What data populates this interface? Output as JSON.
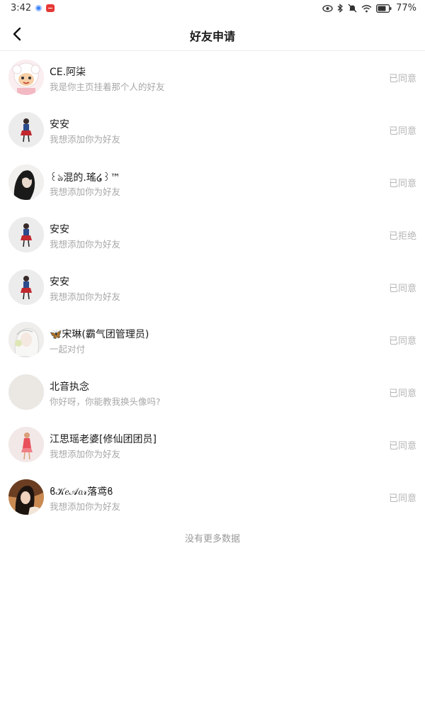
{
  "status_bar": {
    "time": "3:42",
    "battery": "77%",
    "icons": [
      "eye-icon",
      "bluetooth-icon",
      "mute-icon",
      "wifi-icon",
      "battery-icon"
    ]
  },
  "header": {
    "title": "好友申请",
    "back_icon": "back-arrow-icon"
  },
  "requests": [
    {
      "name": "CE.阿柒",
      "message": "我是你主页挂着那个人的好友",
      "status": "已同意"
    },
    {
      "name": "安安",
      "message": "我想添加你为好友",
      "status": "已同意"
    },
    {
      "name": "꒰ঌ混的.瑤໒꒱™",
      "message": "我想添加你为好友",
      "status": "已同意"
    },
    {
      "name": "安安",
      "message": "我想添加你为好友",
      "status": "已拒绝"
    },
    {
      "name": "安安",
      "message": "我想添加你为好友",
      "status": "已同意"
    },
    {
      "name": "🦋宋琳(霸气团管理员)",
      "message": "一起对付",
      "status": "已同意"
    },
    {
      "name": "北音执念",
      "message": "你好呀，你能教我换头像吗?",
      "status": "已同意"
    },
    {
      "name": "江思瑶老婆[修仙团团员]",
      "message": "我想添加你为好友",
      "status": "已同意"
    },
    {
      "name": "ϐ𝒦𝑒𝒜𝑎𝓇落鸢ϐ",
      "message": "我想添加你为好友",
      "status": "已同意"
    }
  ],
  "footer": {
    "no_more": "没有更多数据"
  },
  "colors": {
    "status_text": "#b5b5b5",
    "secondary_text": "#a8a8a8",
    "divider": "#ececec"
  }
}
